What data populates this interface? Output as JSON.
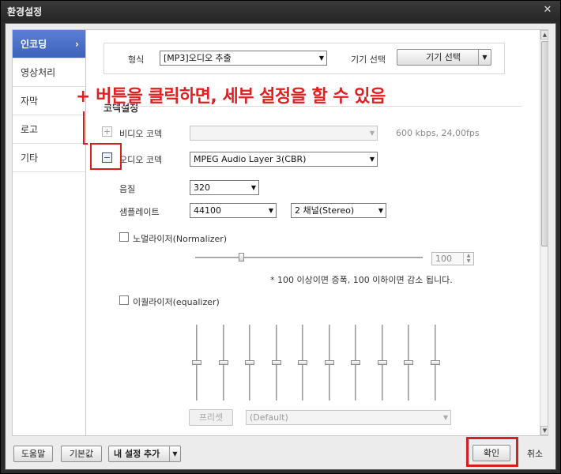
{
  "window": {
    "title": "환경설정",
    "close_glyph": "✕"
  },
  "sidebar": {
    "items": [
      {
        "label": "인코딩",
        "active": true,
        "chevron": "›"
      },
      {
        "label": "영상처리",
        "active": false
      },
      {
        "label": "자막",
        "active": false
      },
      {
        "label": "로고",
        "active": false
      },
      {
        "label": "기타",
        "active": false
      }
    ]
  },
  "format_row": {
    "format_label": "형식",
    "format_value": "[MP3]오디오 추출",
    "device_label": "기기 선택",
    "device_button": "기기 선택"
  },
  "section": {
    "title": "코덱설정"
  },
  "video_codec": {
    "toggle": "+",
    "label": "비디오 코덱",
    "value": "",
    "info": "600 kbps, 24,00fps"
  },
  "audio_codec": {
    "toggle": "−",
    "label": "오디오 코덱",
    "value": "MPEG Audio Layer 3(CBR)"
  },
  "quality": {
    "label": "음질",
    "value": "320"
  },
  "samplerate": {
    "label": "샘플레이트",
    "rate_value": "44100",
    "channel_value": "2 채널(Stereo)"
  },
  "normalizer": {
    "label": "노멀라이저(Normalizer)",
    "checked": false,
    "value": "100",
    "level": 100,
    "note": "* 100 이상이면 증폭, 100 이하이면 감소 됩니다."
  },
  "equalizer": {
    "label": "이퀄라이저(equalizer)",
    "checked": false,
    "band_count": 10,
    "preset_button": "프리셋",
    "preset_value": "(Default)"
  },
  "annotation": {
    "text": "+ 버튼을 클릭하면, 세부 설정을 할 수 있음"
  },
  "footer": {
    "help": "도움말",
    "default": "기본값",
    "add_setting": "내 설정 추가",
    "ok": "확인",
    "cancel": "취소"
  },
  "colors": {
    "accent": "#3d63b8",
    "annotation_red": "#e02020"
  },
  "icons": {
    "close": "close-icon",
    "dropdown": "chevron-down-icon",
    "sidebar_arrow": "chevron-right-icon"
  }
}
